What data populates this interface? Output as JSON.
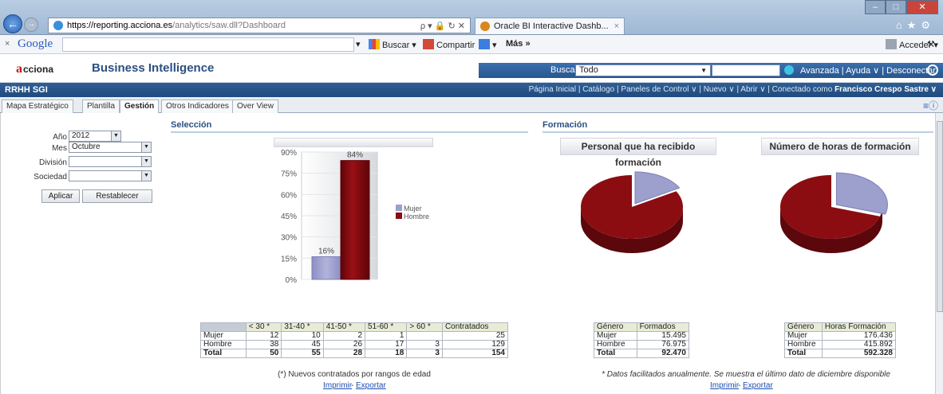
{
  "browser": {
    "url_domain": "https://reporting.acciona.es",
    "url_path": "/analytics/saw.dll?Dashboard",
    "url_tools": "ρ ▾ 🔒 ↻ ✕",
    "tab_title": "Oracle BI Interactive Dashb...",
    "tab_close": "×",
    "win_min": "–",
    "win_max": "□",
    "win_close": "✕",
    "right_icons": "⌂★⚙"
  },
  "google_toolbar": {
    "close": "×",
    "logo": "Google",
    "buscar": "Buscar ▾",
    "compartir": "Compartir",
    "mas": "Más »",
    "acceder": "Acceder ▾"
  },
  "app": {
    "logo_initial": "a",
    "logo_text": "cciona",
    "title": "Business Intelligence",
    "search_label": "Buscar",
    "search_scope": "Todo",
    "links": "Avanzada  |  Ayuda ∨  |  Desconectar"
  },
  "dashboard": {
    "name": "RRHH SGI",
    "nav_prefix": "Página Inicial  |  Catálogo  |  Paneles de Control ∨  |  Nuevo ∨  |  Abrir ∨  |  Conectado como",
    "user": "Francisco Crespo Sastre ∨"
  },
  "tabs": [
    "Mapa Estratégico",
    "Plantilla",
    "Gestión",
    "Otros Indicadores",
    "Over View"
  ],
  "filters": {
    "year_label": "Año",
    "year_value": "2012",
    "month_label": "Mes",
    "month_value": "Octubre",
    "division_label": "División",
    "division_value": "",
    "company_label": "Sociedad",
    "company_value": "",
    "apply": "Aplicar",
    "reset": "Restablecer"
  },
  "seleccion": {
    "title": "Selección",
    "table_headers": [
      "",
      "< 30 *",
      "31-40 *",
      "41-50 *",
      "51-60 *",
      "> 60 *",
      "Contratados"
    ],
    "rows": [
      [
        "Mujer",
        "12",
        "10",
        "2",
        "1",
        "",
        "25"
      ],
      [
        "Hombre",
        "38",
        "45",
        "26",
        "17",
        "3",
        "129"
      ]
    ],
    "total": [
      "Total",
      "50",
      "55",
      "28",
      "18",
      "3",
      "154"
    ],
    "note": "(*) Nuevos contratados por rangos de edad",
    "print": "Imprimir",
    "export": "Exportar"
  },
  "formacion": {
    "title": "Formación",
    "chart1_title": "Personal que ha recibido formación",
    "chart2_title": "Número de horas de formación",
    "table1_headers": [
      "Género",
      "Formados"
    ],
    "table1_rows": [
      [
        "Mujer",
        "15.495"
      ],
      [
        "Hombre",
        "76.975"
      ]
    ],
    "table1_total": [
      "Total",
      "92.470"
    ],
    "table2_headers": [
      "Género",
      "Horas Formación"
    ],
    "table2_rows": [
      [
        "Mujer",
        "176.436"
      ],
      [
        "Hombre",
        "415.892"
      ]
    ],
    "table2_total": [
      "Total",
      "592.328"
    ],
    "note": "* Datos facilitados anualmente. Se muestra el último dato de diciembre disponible",
    "print": "Imprimir",
    "export": "Exportar"
  },
  "colors": {
    "mujer": "#9d9fcd",
    "hombre": "#8b0d12",
    "accent": "#2b4f82"
  },
  "chart_data": [
    {
      "type": "bar",
      "categories": [
        ""
      ],
      "series": [
        {
          "name": "Mujer",
          "values": [
            16
          ]
        },
        {
          "name": "Hombre",
          "values": [
            84
          ]
        }
      ],
      "data_labels": [
        "16%",
        "84%"
      ],
      "ylim": [
        0,
        90
      ],
      "yticks": [
        "0%",
        "15%",
        "30%",
        "45%",
        "60%",
        "75%",
        "90%"
      ],
      "legend": "right",
      "grid": true
    },
    {
      "type": "pie",
      "title": "Personal que ha recibido formación",
      "labels": [
        "Mujer",
        "Hombre"
      ],
      "values": [
        15495,
        76975
      ]
    },
    {
      "type": "pie",
      "title": "Número de horas de formación",
      "labels": [
        "Mujer",
        "Hombre"
      ],
      "values": [
        176436,
        415892
      ]
    }
  ]
}
